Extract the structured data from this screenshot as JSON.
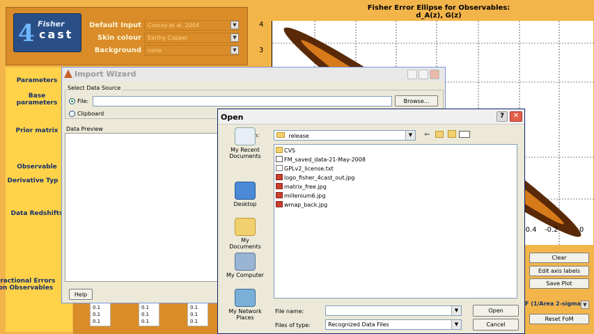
{
  "header": {
    "logo_top": "Fisher",
    "logo_bottom": "cast",
    "logo_number": "4",
    "default_input_label": "Default Input",
    "default_input_value": "Cooray et al. 2004",
    "skin_label": "Skin colour",
    "skin_value": "Earthy Copper",
    "background_label": "Background",
    "background_value": "none"
  },
  "left_panel": {
    "parameters": "Parameters",
    "base_parameters": "Base parameters",
    "prior_matrix": "Prior matrix",
    "observable": "Observable",
    "derivative_type": "Derivative Typ",
    "data_redshifts": "Data Redshifts",
    "fractional_errors": "Fractional Errors on Observables"
  },
  "plot": {
    "title_line1": "Fisher Error Ellipse for Observables:",
    "title_line2": "d_A(z), G(z)",
    "y_ticks": [
      "4",
      "3"
    ],
    "x_ticks": [
      "-0.4",
      "-0.2",
      "0"
    ],
    "ellipse_color": "#5a2a08",
    "ellipse_inner_color": "#d77a1a"
  },
  "right_panel": {
    "clear": "Clear",
    "edit_axis": "Edit axis labels",
    "save_plot": "Save Plot",
    "fom_select": "F (1/Area 2-sigma)",
    "reset_fom": "Reset FoM"
  },
  "steppers": [
    [
      "0.1",
      "0.1",
      "0.1"
    ],
    [
      "0.1",
      "0.1",
      "0.1"
    ],
    [
      "0.1",
      "0.1",
      "0.1"
    ]
  ],
  "wizard": {
    "title": "Import Wizard",
    "select_source": "Select Data Source",
    "file_label": "File:",
    "clipboard_label": "Clipboard",
    "browse": "Browse...",
    "data_preview": "Data Preview",
    "help": "Help"
  },
  "open_dialog": {
    "title": "Open",
    "look_in_label": "Look in:",
    "look_in_value": "release",
    "places": [
      "My Recent Documents",
      "Desktop",
      "My Documents",
      "My Computer",
      "My Network Places"
    ],
    "files": [
      "CVS",
      "FM_saved_data-21-May-2008",
      "GPLv2_license.txt",
      "logo_fisher_4cast_out.jpg",
      "matrix_free.jpg",
      "millenium6.jpg",
      "wmap_back.jpg"
    ],
    "file_name_label": "File name:",
    "file_name_value": "",
    "files_of_type_label": "Files of type:",
    "files_of_type_value": "Recognized Data Files",
    "open_button": "Open",
    "cancel_button": "Cancel"
  }
}
